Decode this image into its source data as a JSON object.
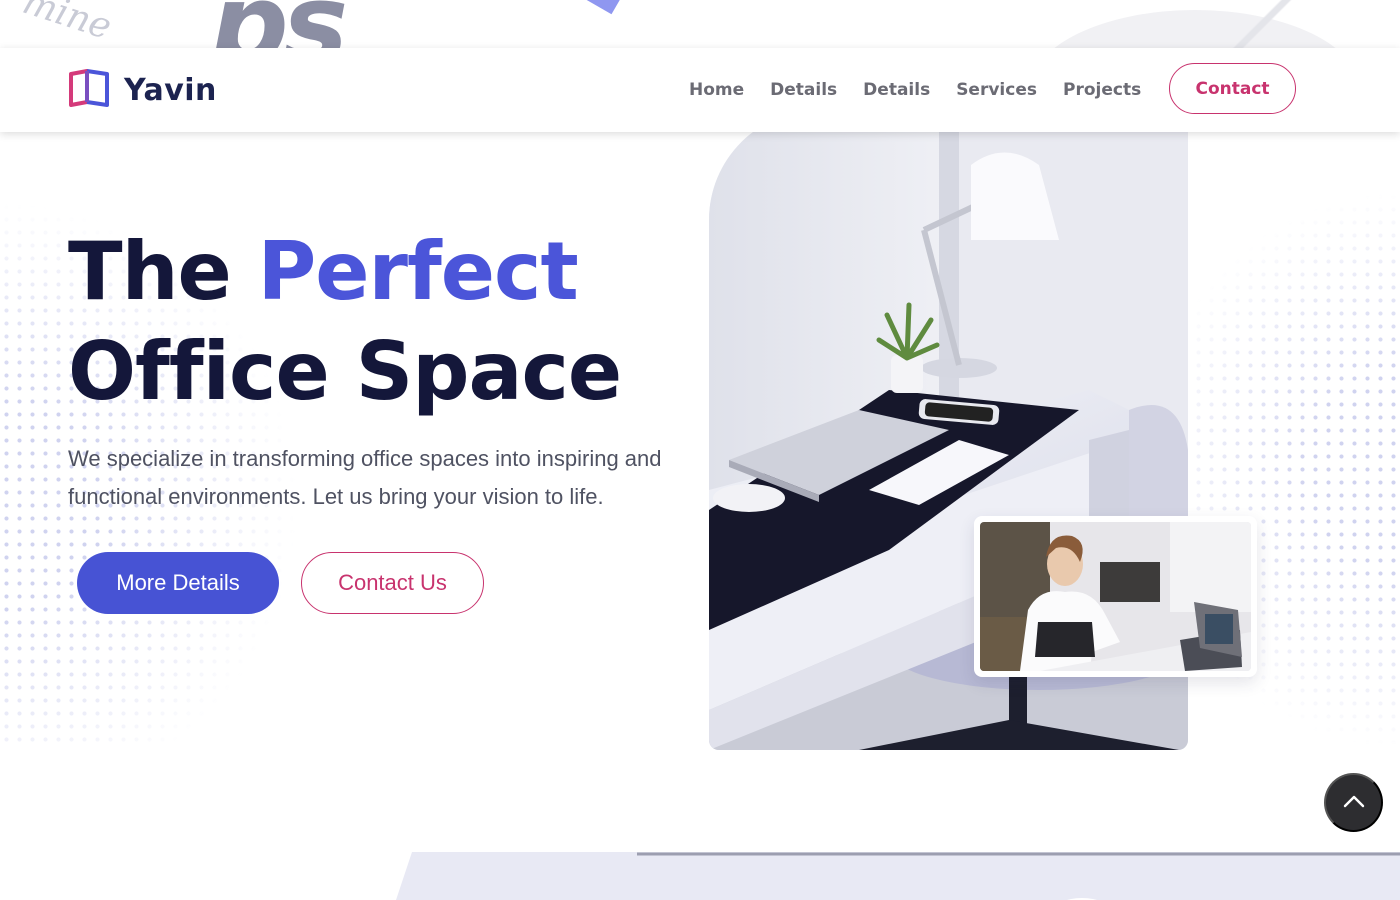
{
  "brand": {
    "name": "Yavin",
    "logo_icon": "open-book-logo-icon",
    "logo_colors": [
      "#d43a7a",
      "#4b55d9"
    ]
  },
  "nav": {
    "items": [
      {
        "label": "Home"
      },
      {
        "label": "Details"
      },
      {
        "label": "Details"
      },
      {
        "label": "Services"
      },
      {
        "label": "Projects"
      }
    ],
    "contact_label": "Contact"
  },
  "hero": {
    "title_word_1": "The",
    "title_accent": "Perfect",
    "title_line_2": "Office Space",
    "description": "We specialize in transforming office spaces into inspiring and functional environments. Let us bring your vision to life.",
    "primary_button": "More Details",
    "secondary_button": "Contact Us",
    "main_image": "office-desk-photo",
    "inset_image": "woman-working-at-laptop-photo"
  },
  "decor": {
    "script_text": "mine",
    "big_letters": "ps"
  },
  "scroll_top": {
    "icon": "chevron-up-icon"
  },
  "colors": {
    "accent_blue": "#4b55d9",
    "primary_button": "#4753d4",
    "accent_pink": "#c8336e",
    "heading_dark": "#14173a",
    "scroll_button": "#2d2d30"
  }
}
